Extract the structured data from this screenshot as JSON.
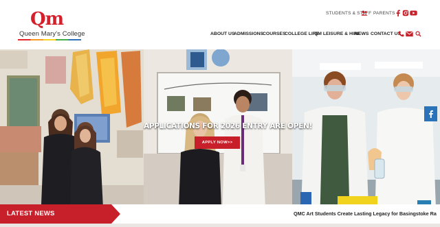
{
  "logo": {
    "mark": "Qm",
    "name": "Queen Mary's College"
  },
  "utility": {
    "students_staff": "STUDENTS & STAFF",
    "parents": "PARENTS"
  },
  "nav": {
    "about": "ABOUT US",
    "admissions": "ADMISSIONS",
    "courses": "COURSES",
    "college_life": "COLLEGE LIFE",
    "qm_leisure": "QM LEISURE & HIRE",
    "news": "NEWS",
    "contact": "CONTACT US"
  },
  "hero": {
    "headline": "APPLICATIONS FOR 2026 ENTRY ARE OPEN!",
    "apply_label": "APPLY NOW>>"
  },
  "latest_news": {
    "label": "LATEST NEWS",
    "ticker": "QMC Art Students Create Lasting Legacy for Basingstoke Railway Statio"
  },
  "icons": [
    "students-staff-icon",
    "facebook-icon",
    "instagram-icon",
    "youtube-icon",
    "phone-icon",
    "mail-icon",
    "search-icon"
  ],
  "colors": {
    "brand_red": "#d4202c",
    "accent_blue": "#2a73b8"
  }
}
